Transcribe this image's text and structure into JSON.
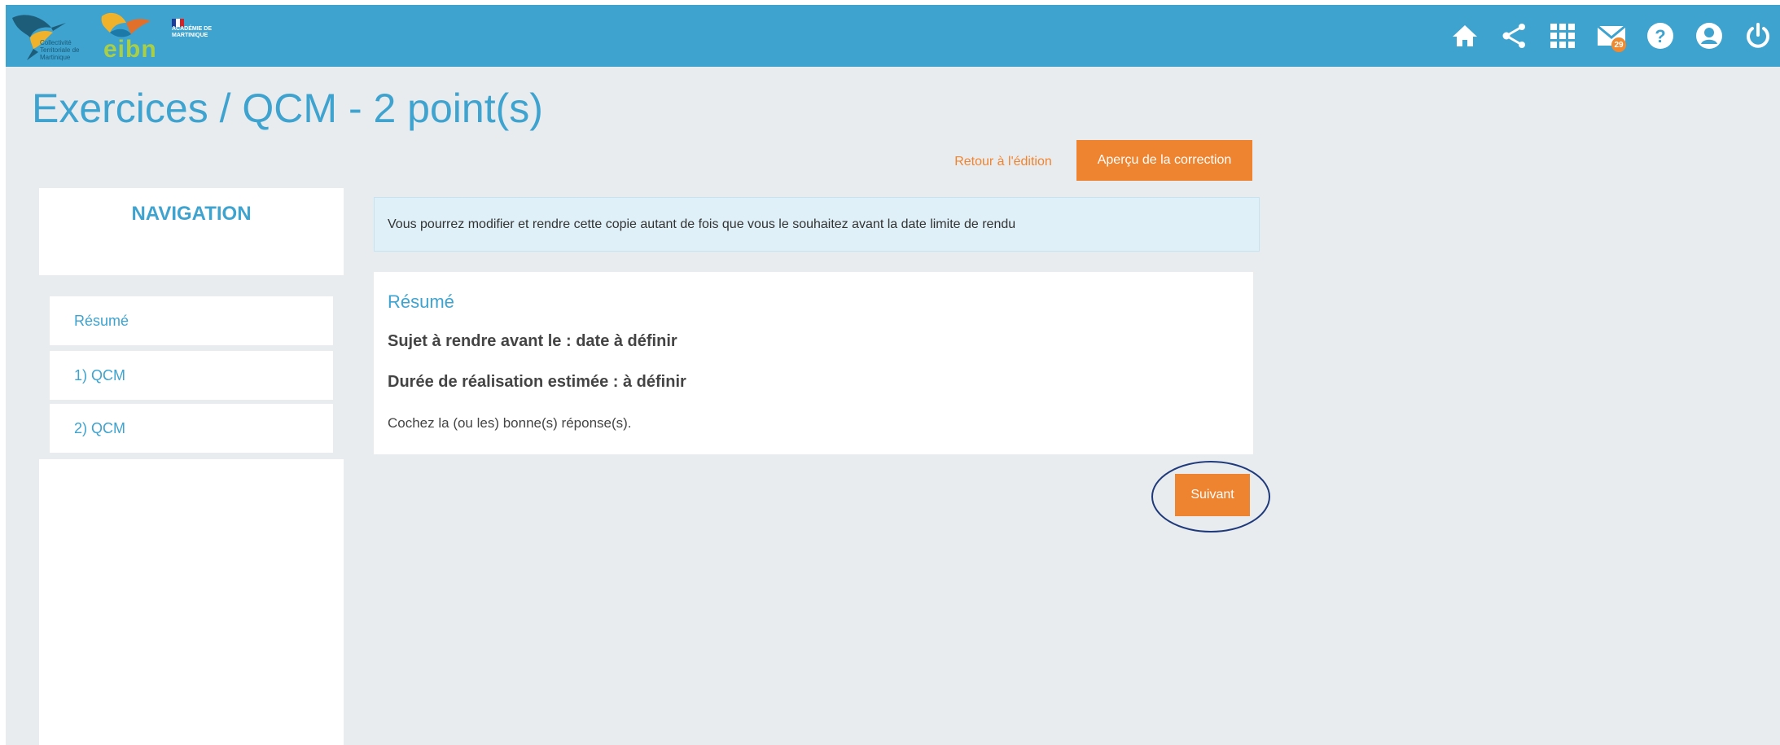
{
  "header": {
    "logos": {
      "collectivite_text": "Collectivité Territoriale de Martinique",
      "eibn_text": "eibn",
      "academie_text": "ACADÉMIE DE MARTINIQUE"
    },
    "icons": [
      "home-icon",
      "share-icon",
      "apps-grid-icon",
      "mail-icon",
      "help-icon",
      "user-icon",
      "power-icon"
    ],
    "mail_badge": "29"
  },
  "page_title": "Exercices / QCM - 2 point(s)",
  "actions": {
    "back_label": "Retour à l'édition",
    "preview_label": "Aperçu de la correction"
  },
  "navigation": {
    "title": "NAVIGATION",
    "items": [
      {
        "label": "Résumé"
      },
      {
        "label": "1) QCM"
      },
      {
        "label": "2) QCM"
      }
    ]
  },
  "alert": {
    "text": "Vous pourrez modifier et rendre cette copie autant de fois que vous le souhaitez avant la date limite de rendu"
  },
  "summary": {
    "title": "Résumé",
    "due_line": "Sujet à rendre avant le : date à définir",
    "duration_line": "Durée de réalisation estimée : à définir",
    "instruction": "Cochez la (ou les) bonne(s) réponse(s)."
  },
  "next_label": "Suivant",
  "colors": {
    "header_blue": "#3ea3cf",
    "accent_orange": "#ef8430",
    "page_bg": "#e9ecef",
    "alert_bg": "#dff0f8",
    "highlight_circle": "#1f3a7a"
  }
}
